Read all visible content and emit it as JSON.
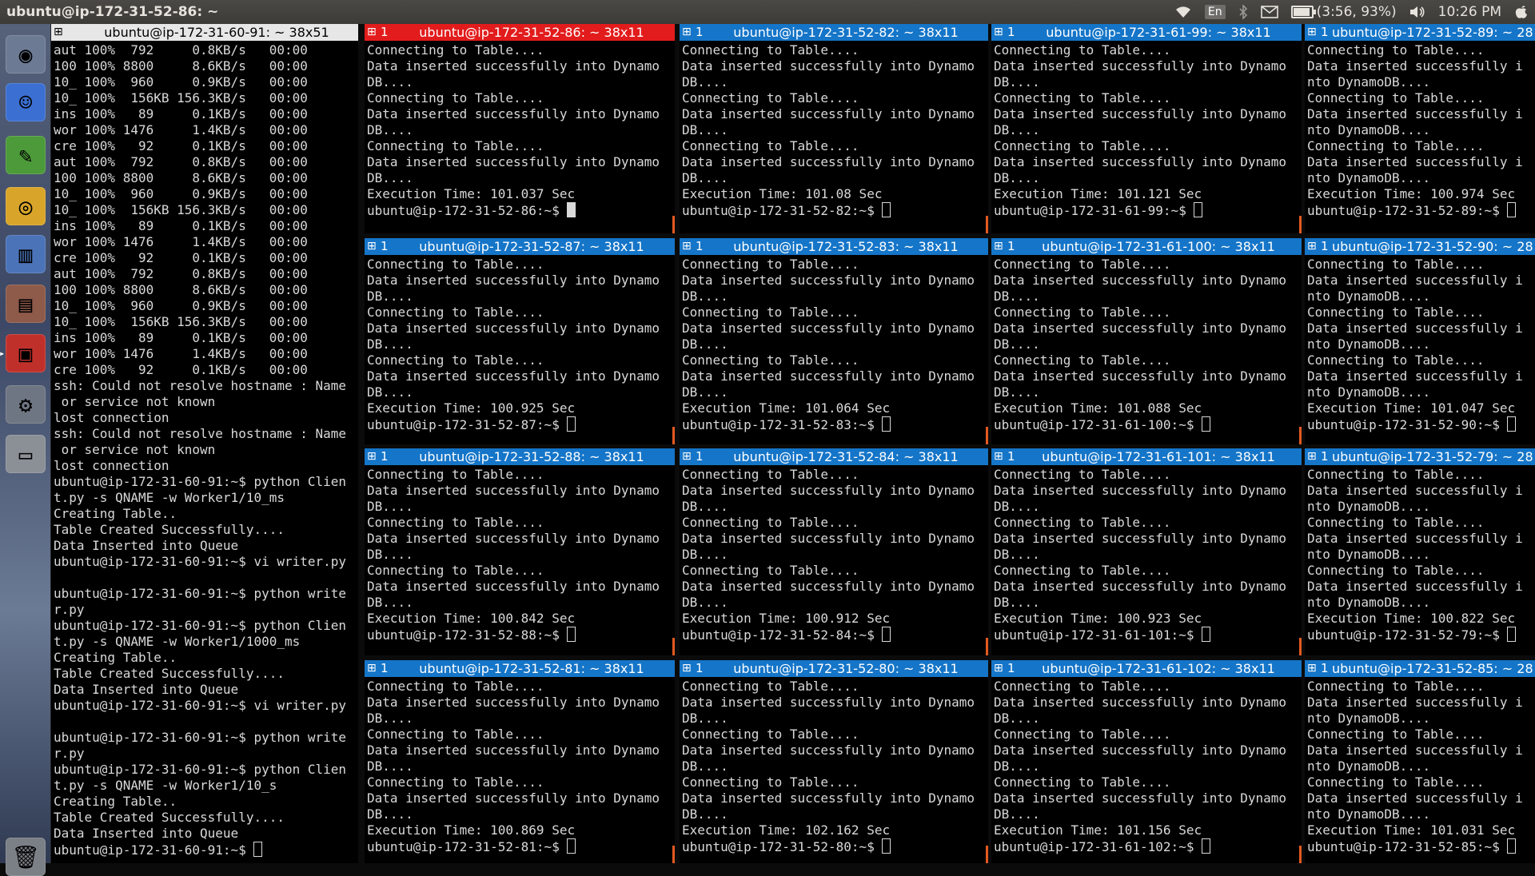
{
  "topbar": {
    "window_title": "ubuntu@ip-172-31-52-86: ~",
    "lang": "En",
    "battery_text": "(3:56, 93%)",
    "battery_percent": 93,
    "clock": "10:26 PM"
  },
  "launcher": {
    "items": [
      {
        "name": "dash-icon",
        "glyph": "◉",
        "color": "#6c7a93"
      },
      {
        "name": "finder-icon",
        "glyph": "☺",
        "color": "#3b6fd1"
      },
      {
        "name": "pencil-app-icon",
        "glyph": "✎",
        "color": "#4c9a3a"
      },
      {
        "name": "chrome-icon",
        "glyph": "◎",
        "color": "#d8a52a"
      },
      {
        "name": "chart-app-icon",
        "glyph": "▥",
        "color": "#4b73b8"
      },
      {
        "name": "system-monitor-icon",
        "glyph": "▤",
        "color": "#8e5a4a"
      },
      {
        "name": "terminal-app-icon",
        "glyph": "▣",
        "color": "#c0302b"
      },
      {
        "name": "settings-icon",
        "glyph": "⚙",
        "color": "#6f7683"
      },
      {
        "name": "drive-icon",
        "glyph": "▭",
        "color": "#8b8f96"
      },
      {
        "name": "trash-icon",
        "glyph": "🗑",
        "color": "#7b7f86"
      }
    ]
  },
  "terminals": {
    "big": {
      "title": "ubuntu@ip-172-31-60-91: ~ 38x51",
      "lines": [
        "aut 100%  792     0.8KB/s   00:00",
        "100 100% 8800     8.6KB/s   00:00",
        "10_ 100%  960     0.9KB/s   00:00",
        "10_ 100%  156KB 156.3KB/s   00:00",
        "ins 100%   89     0.1KB/s   00:00",
        "wor 100% 1476     1.4KB/s   00:00",
        "cre 100%   92     0.1KB/s   00:00",
        "aut 100%  792     0.8KB/s   00:00",
        "100 100% 8800     8.6KB/s   00:00",
        "10_ 100%  960     0.9KB/s   00:00",
        "10_ 100%  156KB 156.3KB/s   00:00",
        "ins 100%   89     0.1KB/s   00:00",
        "wor 100% 1476     1.4KB/s   00:00",
        "cre 100%   92     0.1KB/s   00:00",
        "aut 100%  792     0.8KB/s   00:00",
        "100 100% 8800     8.6KB/s   00:00",
        "10_ 100%  960     0.9KB/s   00:00",
        "10_ 100%  156KB 156.3KB/s   00:00",
        "ins 100%   89     0.1KB/s   00:00",
        "wor 100% 1476     1.4KB/s   00:00",
        "cre 100%   92     0.1KB/s   00:00",
        "ssh: Could not resolve hostname : Name",
        " or service not known",
        "lost connection",
        "ssh: Could not resolve hostname : Name",
        " or service not known",
        "lost connection",
        "ubuntu@ip-172-31-60-91:~$ python Clien",
        "t.py -s QNAME -w Worker1/10_ms",
        "Creating Table..",
        "Table Created Successfully....",
        "Data Inserted into Queue",
        "ubuntu@ip-172-31-60-91:~$ vi writer.py",
        "",
        "ubuntu@ip-172-31-60-91:~$ python write",
        "r.py",
        "ubuntu@ip-172-31-60-91:~$ python Clien",
        "t.py -s QNAME -w Worker1/1000_ms",
        "Creating Table..",
        "Table Created Successfully....",
        "Data Inserted into Queue",
        "ubuntu@ip-172-31-60-91:~$ vi writer.py",
        "",
        "ubuntu@ip-172-31-60-91:~$ python write",
        "r.py",
        "ubuntu@ip-172-31-60-91:~$ python Clien",
        "t.py -s QNAME -w Worker1/10_s",
        "Creating Table..",
        "Table Created Successfully....",
        "Data Inserted into Queue",
        "ubuntu@ip-172-31-60-91:~$ "
      ]
    },
    "grid": [
      {
        "num": "1",
        "title": "ubuntu@ip-172-31-52-86: ~ 38x11",
        "exec": "Execution Time: 101.037 Sec",
        "prompt": "ubuntu@ip-172-31-52-86:~$ "
      },
      {
        "num": "1",
        "title": "ubuntu@ip-172-31-52-82: ~ 38x11",
        "exec": "Execution Time: 101.08 Sec",
        "prompt": "ubuntu@ip-172-31-52-82:~$ "
      },
      {
        "num": "1",
        "title": "ubuntu@ip-172-31-61-99: ~ 38x11",
        "exec": "Execution Time: 101.121 Sec",
        "prompt": "ubuntu@ip-172-31-61-99:~$ "
      },
      {
        "num": "1",
        "title": "ubuntu@ip-172-31-52-89: ~ 28",
        "exec": "Execution Time: 100.974 Sec",
        "prompt": "ubuntu@ip-172-31-52-89:~$ "
      },
      {
        "num": "1",
        "title": "ubuntu@ip-172-31-52-87: ~ 38x11",
        "exec": "Execution Time: 100.925 Sec",
        "prompt": "ubuntu@ip-172-31-52-87:~$ "
      },
      {
        "num": "1",
        "title": "ubuntu@ip-172-31-52-83: ~ 38x11",
        "exec": "Execution Time: 101.064 Sec",
        "prompt": "ubuntu@ip-172-31-52-83:~$ "
      },
      {
        "num": "1",
        "title": "ubuntu@ip-172-31-61-100: ~ 38x11",
        "exec": "Execution Time: 101.088 Sec",
        "prompt": "ubuntu@ip-172-31-61-100:~$ "
      },
      {
        "num": "1",
        "title": "ubuntu@ip-172-31-52-90: ~ 28",
        "exec": "Execution Time: 101.047 Sec",
        "prompt": "ubuntu@ip-172-31-52-90:~$ "
      },
      {
        "num": "1",
        "title": "ubuntu@ip-172-31-52-88: ~ 38x11",
        "exec": "Execution Time: 100.842 Sec",
        "prompt": "ubuntu@ip-172-31-52-88:~$ "
      },
      {
        "num": "1",
        "title": "ubuntu@ip-172-31-52-84: ~ 38x11",
        "exec": "Execution Time: 100.912 Sec",
        "prompt": "ubuntu@ip-172-31-52-84:~$ "
      },
      {
        "num": "1",
        "title": "ubuntu@ip-172-31-61-101: ~ 38x11",
        "exec": "Execution Time: 100.923 Sec",
        "prompt": "ubuntu@ip-172-31-61-101:~$ "
      },
      {
        "num": "1",
        "title": "ubuntu@ip-172-31-52-79: ~ 28",
        "exec": "Execution Time: 100.822 Sec",
        "prompt": "ubuntu@ip-172-31-52-79:~$ "
      },
      {
        "num": "1",
        "title": "ubuntu@ip-172-31-52-81: ~ 38x11",
        "exec": "Execution Time: 100.869 Sec",
        "prompt": "ubuntu@ip-172-31-52-81:~$ "
      },
      {
        "num": "1",
        "title": "ubuntu@ip-172-31-52-80: ~ 38x11",
        "exec": "Execution Time: 102.162 Sec",
        "prompt": "ubuntu@ip-172-31-52-80:~$ "
      },
      {
        "num": "1",
        "title": "ubuntu@ip-172-31-61-102: ~ 38x11",
        "exec": "Execution Time: 101.156 Sec",
        "prompt": "ubuntu@ip-172-31-61-102:~$ "
      },
      {
        "num": "1",
        "title": "ubuntu@ip-172-31-52-85: ~ 28",
        "exec": "Execution Time: 101.031 Sec",
        "prompt": "ubuntu@ip-172-31-52-85:~$ "
      }
    ],
    "wide_lines": [
      "Connecting to Table....",
      "Data inserted successfully into Dynamo",
      "DB....",
      "Connecting to Table....",
      "Data inserted successfully into Dynamo",
      "DB....",
      "Connecting to Table....",
      "Data inserted successfully into Dynamo",
      "DB...."
    ],
    "narrow_lines": [
      "Connecting to Table....",
      "Data inserted successfully i",
      "nto DynamoDB....",
      "Connecting to Table....",
      "Data inserted successfully i",
      "nto DynamoDB....",
      "Connecting to Table....",
      "Data inserted successfully i",
      "nto DynamoDB...."
    ],
    "focused_index": 0
  }
}
